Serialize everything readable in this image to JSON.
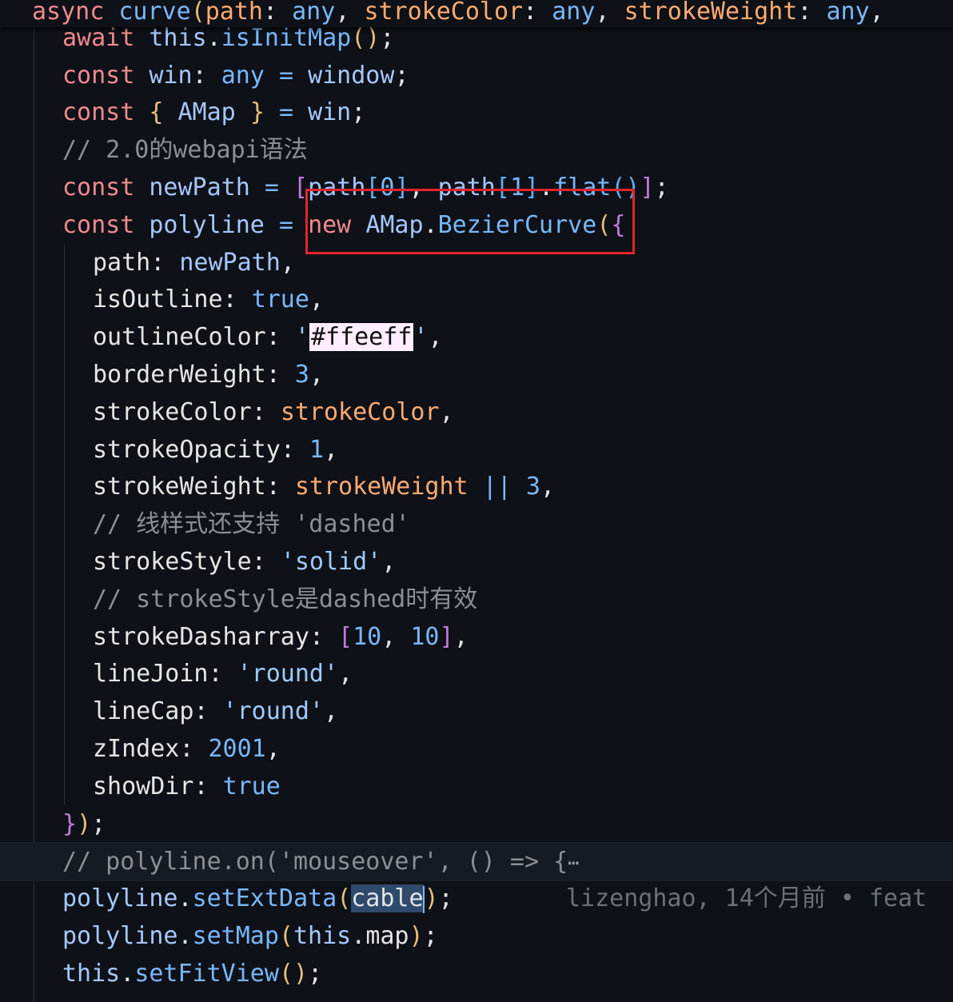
{
  "sticky": {
    "kw_async": "async",
    "fn_name": "curve",
    "p_path": "path",
    "t1": "any",
    "p_color": "strokeColor",
    "t2": "any",
    "p_weight": "strokeWeight",
    "t3": "any"
  },
  "code": {
    "l1_this": "this",
    "l1_call": "isInitMap",
    "l1_await": "await",
    "l2_const": "const",
    "l2_name": "win",
    "l2_type": "any",
    "l2_val": "window",
    "l3_const": "const",
    "l3_name": "AMap",
    "l3_val": "win",
    "l4_comment": "// 2.0的webapi语法",
    "l5_const": "const",
    "l5_name": "newPath",
    "l5_a": "path",
    "l5_i0": "0",
    "l5_b": "path",
    "l5_i1": "1",
    "l5_flat": "flat",
    "l6_const": "const",
    "l6_name": "polyline",
    "l6_new": "new",
    "l6_ns": "AMap",
    "l6_cls": "BezierCurve",
    "props": {
      "path_k": "path",
      "path_v": "newPath",
      "isOutline_k": "isOutline",
      "isOutline_v": "true",
      "outlineColor_k": "outlineColor",
      "outlineColor_v": "#ffeeff",
      "borderWeight_k": "borderWeight",
      "borderWeight_v": "3",
      "strokeColor_k": "strokeColor",
      "strokeColor_v": "strokeColor",
      "strokeOpacity_k": "strokeOpacity",
      "strokeOpacity_v": "1",
      "strokeWeight_k": "strokeWeight",
      "strokeWeight_v": "strokeWeight",
      "strokeWeight_or": "||",
      "strokeWeight_d": "3",
      "cmt1": "// 线样式还支持 'dashed'",
      "strokeStyle_k": "strokeStyle",
      "strokeStyle_v": "'solid'",
      "cmt2": "// strokeStyle是dashed时有效",
      "dash_k": "strokeDasharray",
      "dash_a": "10",
      "dash_b": "10",
      "lineJoin_k": "lineJoin",
      "lineJoin_v": "'round'",
      "lineCap_k": "lineCap",
      "lineCap_v": "'round'",
      "zIndex_k": "zIndex",
      "zIndex_v": "2001",
      "showDir_k": "showDir",
      "showDir_v": "true"
    },
    "folded_comment": "// polyline.on('mouseover', () => {",
    "fold_glyph": "⋯",
    "l_ext_obj": "polyline",
    "l_ext_fn": "setExtData",
    "l_ext_arg": "cable",
    "blame": "lizenghao, 14个月前 • feat",
    "l_map_obj": "polyline",
    "l_map_fn": "setMap",
    "l_map_this": "this",
    "l_map_prop": "map",
    "l_fit_this": "this",
    "l_fit_fn": "setFitView"
  },
  "colors": {
    "background": "#0e1117",
    "highlight_box": "#e0262c",
    "color_swatch": "#ffeeff"
  }
}
